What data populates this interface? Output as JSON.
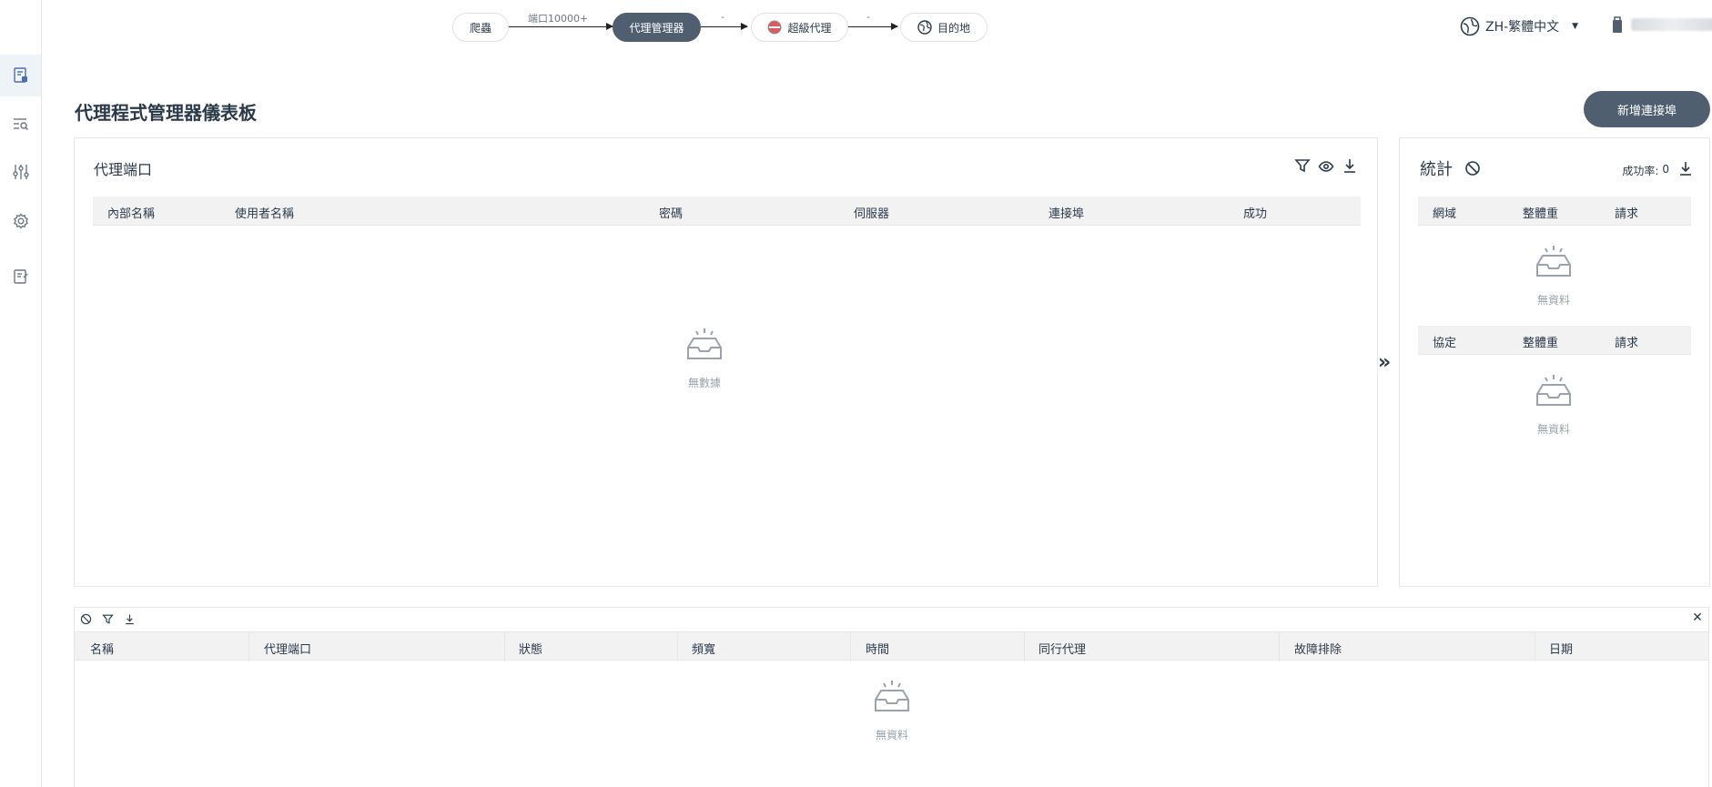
{
  "flow": {
    "node1": "爬蟲",
    "edge1_label": "端口10000+",
    "node2": "代理管理器",
    "edge2_label": "-",
    "node3": "超級代理",
    "edge3_label": "-",
    "node4": "目的地"
  },
  "header": {
    "language": "ZH-繁體中文"
  },
  "page": {
    "title": "代理程式管理器儀表板",
    "add_button": "新增連接埠"
  },
  "ports_panel": {
    "title": "代理端口",
    "columns": [
      "內部名稱",
      "使用者名稱",
      "密碼",
      "伺服器",
      "連接埠",
      "成功"
    ],
    "empty_text": "無數據"
  },
  "stats_panel": {
    "title": "統計",
    "success_rate_label": "成功率:",
    "success_rate_value": "0",
    "domain_table": {
      "columns": [
        "網域",
        "整體重",
        "請求"
      ],
      "empty_text": "無資料"
    },
    "protocol_table": {
      "columns": [
        "協定",
        "整體重",
        "請求"
      ],
      "empty_text": "無資料"
    }
  },
  "log_panel": {
    "columns": [
      "名稱",
      "代理端口",
      "狀態",
      "頻寬",
      "時間",
      "同行代理",
      "故障排除",
      "日期"
    ],
    "empty_text": "無資料"
  }
}
